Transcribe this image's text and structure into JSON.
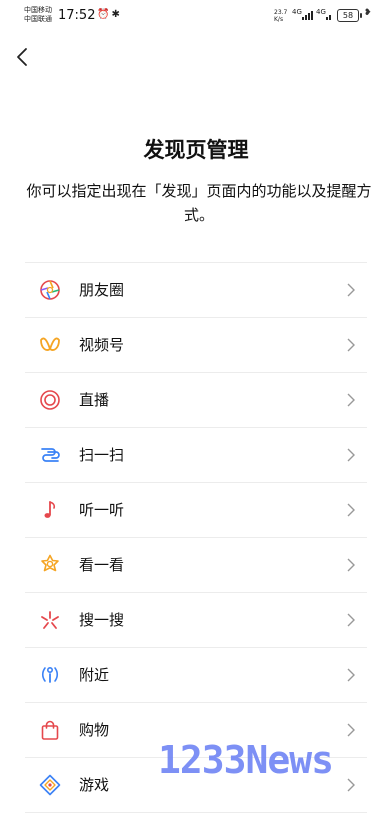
{
  "status_bar": {
    "carrier_1": "中国移动",
    "carrier_2": "中国联通",
    "time": "17:52",
    "speed_value": "23.7",
    "speed_unit": "K/s",
    "net_1": "4G",
    "net_2": "4G",
    "battery": "58"
  },
  "page": {
    "title": "发现页管理",
    "description": "你可以指定出现在「发现」页面内的功能以及提醒方式。"
  },
  "items": [
    {
      "label": "朋友圈",
      "icon": "moments-icon"
    },
    {
      "label": "视频号",
      "icon": "channels-icon"
    },
    {
      "label": "直播",
      "icon": "live-icon"
    },
    {
      "label": "扫一扫",
      "icon": "scan-icon"
    },
    {
      "label": "听一听",
      "icon": "music-note-icon"
    },
    {
      "label": "看一看",
      "icon": "top-stories-icon"
    },
    {
      "label": "搜一搜",
      "icon": "search-sparkle-icon"
    },
    {
      "label": "附近",
      "icon": "nearby-icon"
    },
    {
      "label": "购物",
      "icon": "shopping-bag-icon"
    },
    {
      "label": "游戏",
      "icon": "game-icon"
    }
  ],
  "watermark": "1233News"
}
